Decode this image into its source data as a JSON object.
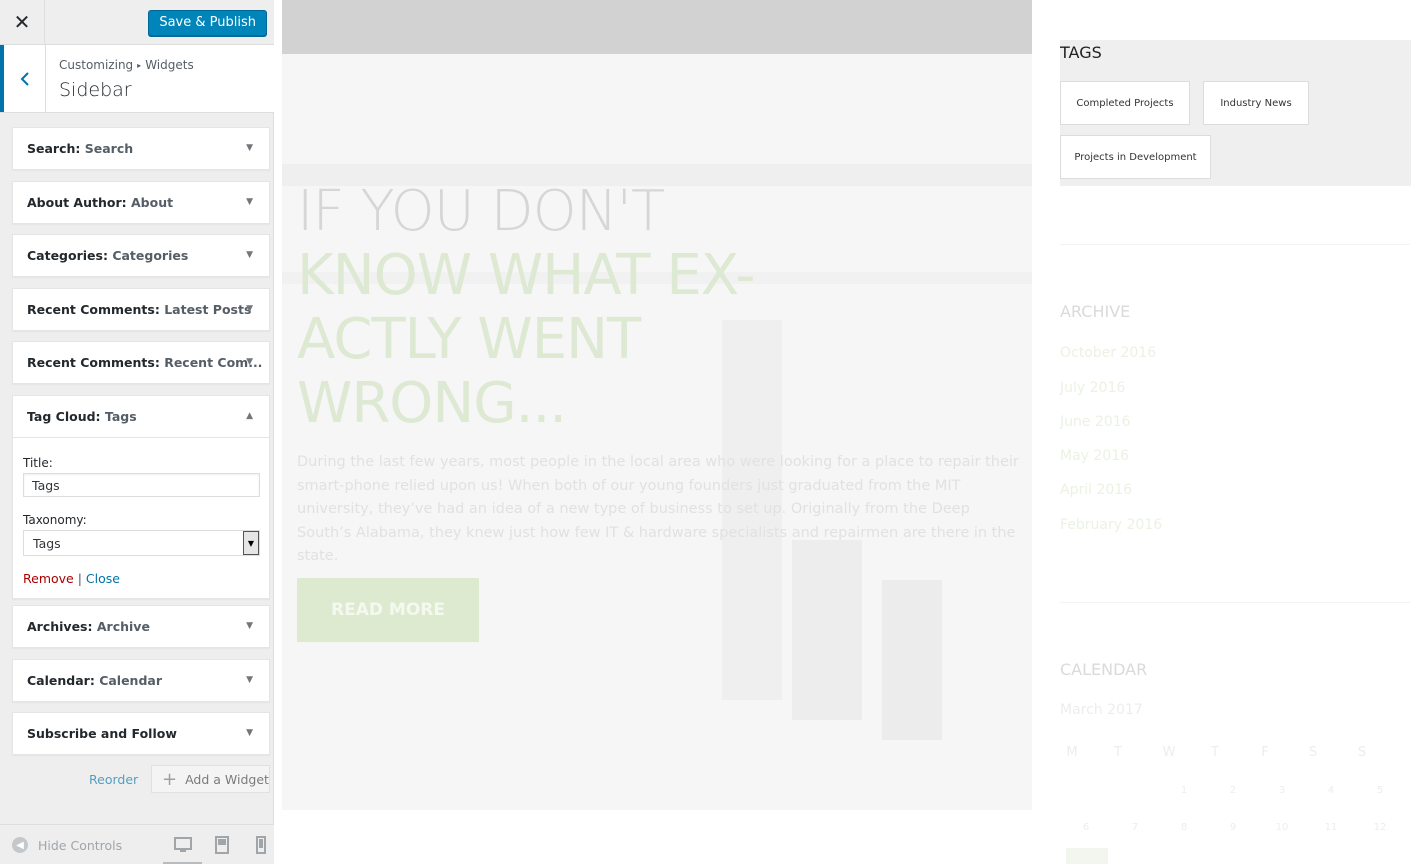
{
  "customizer": {
    "close_glyph": "✕",
    "publish_label": "Save & Publish",
    "breadcrumb": {
      "parent": "Customizing",
      "separator": "▸",
      "current": "Widgets"
    },
    "section_title": "Sidebar",
    "widgets": [
      {
        "type": "Search",
        "name": "Search",
        "expanded": false
      },
      {
        "type": "About Author",
        "name": "About",
        "expanded": false
      },
      {
        "type": "Categories",
        "name": "Categories",
        "expanded": false
      },
      {
        "type": "Recent Comments",
        "name": "Latest Posts",
        "expanded": false
      },
      {
        "type": "Recent Comments",
        "name": "Recent Com...",
        "expanded": false
      },
      {
        "type": "Tag Cloud",
        "name": "Tags",
        "expanded": true
      },
      {
        "type": "Archives",
        "name": "Archive",
        "expanded": false
      },
      {
        "type": "Calendar",
        "name": "Calendar",
        "expanded": false
      },
      {
        "type": "Subscribe and Follow",
        "name": "",
        "expanded": false
      }
    ],
    "tag_cloud_form": {
      "title_label": "Title:",
      "title_value": "Tags",
      "taxonomy_label": "Taxonomy:",
      "taxonomy_value": "Tags",
      "remove_label": "Remove",
      "separator": "|",
      "close_label": "Close"
    },
    "reorder_label": "Reorder",
    "add_widget_label": "Add a Widget",
    "hide_controls_label": "Hide Controls",
    "devices": [
      "desktop-icon",
      "tablet-icon",
      "mobile-icon"
    ],
    "selected_device": "desktop",
    "accent_color": "#0073aa",
    "publish_color": "#0085ba"
  },
  "preview": {
    "hero": {
      "title_light": "IF YOU DON'T",
      "title_green": "KNOW WHAT EX-\nACTLY WENT\nWRONG...",
      "body": "During the last few years, most people in the local area who were looking for a place to repair their smart-phone relied upon us! When both of our young founders just graduated from the MIT university, they’ve had an idea of a new type of business to set up. Originally from the Deep South’s Alabama, they knew just how few IT & hardware specialists and repairmen are there in the state.",
      "button": "READ MORE"
    },
    "sidebar": {
      "tags_title": "TAGS",
      "tags": [
        "Completed Projects",
        "Industry News",
        "Projects in Development"
      ],
      "archive_title": "ARCHIVE",
      "archive": [
        "October 2016",
        "July 2016",
        "June 2016",
        "May 2016",
        "April 2016",
        "February 2016"
      ],
      "calendar_title": "CALENDAR",
      "calendar_month": "March 2017",
      "weekdays": [
        "M",
        "T",
        "W",
        "T",
        "F",
        "S",
        "S"
      ],
      "week1": [
        "1",
        "2",
        "3",
        "4",
        "5"
      ],
      "week2": [
        "6",
        "7",
        "8",
        "9",
        "10",
        "11",
        "12"
      ]
    }
  }
}
